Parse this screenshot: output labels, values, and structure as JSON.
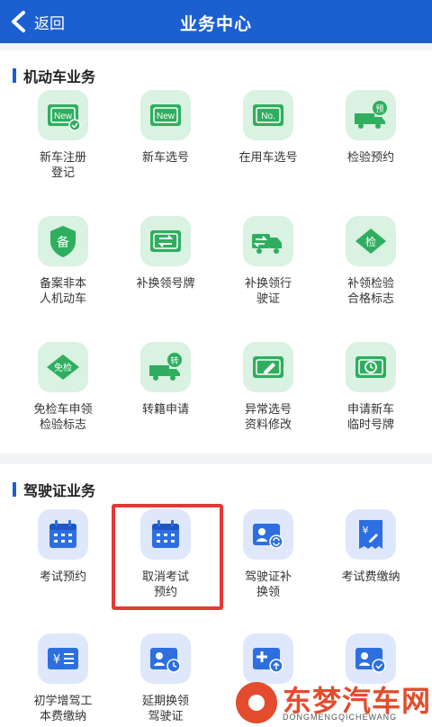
{
  "header": {
    "back_label": "返回",
    "title": "业务中心"
  },
  "motor": {
    "title": "机动车业务",
    "items": [
      {
        "label": "新车注册\n登记",
        "icon": "new-car-register-icon"
      },
      {
        "label": "新车选号",
        "icon": "new-plate-icon"
      },
      {
        "label": "在用车选号",
        "icon": "number-plate-icon"
      },
      {
        "label": "检验预约",
        "icon": "truck-reserve-icon"
      },
      {
        "label": "备案非本\n人机动车",
        "icon": "record-shield-icon"
      },
      {
        "label": "补换领号牌",
        "icon": "plate-exchange-icon"
      },
      {
        "label": "补换领行\n驶证",
        "icon": "license-exchange-icon"
      },
      {
        "label": "补领检验\n合格标志",
        "icon": "inspection-badge-icon"
      },
      {
        "label": "免检车申领\n检验标志",
        "icon": "exempt-badge-icon"
      },
      {
        "label": "转籍申请",
        "icon": "truck-transfer-icon"
      },
      {
        "label": "异常选号\n资料修改",
        "icon": "edit-plate-icon"
      },
      {
        "label": "申请新车\n临时号牌",
        "icon": "temp-plate-icon"
      }
    ]
  },
  "driving": {
    "title": "驾驶证业务",
    "items": [
      {
        "label": "考试预约",
        "icon": "calendar-icon"
      },
      {
        "label": "取消考试\n预约",
        "icon": "calendar-cancel-icon"
      },
      {
        "label": "驾驶证补\n换领",
        "icon": "license-renew-icon"
      },
      {
        "label": "考试费缴纳",
        "icon": "receipt-icon"
      },
      {
        "label": "初学增驾工\n本费缴纳",
        "icon": "fee-icon"
      },
      {
        "label": "延期换领\n驾驶证",
        "icon": "license-delay-icon"
      },
      {
        "label": "",
        "icon": "license-add-icon"
      },
      {
        "label": "",
        "icon": "license-check-icon"
      }
    ]
  },
  "watermark": {
    "text": "东梦汽车网",
    "sub": "DONGMENGQICHEWANG"
  },
  "colors": {
    "primary": "#1c5fd1",
    "green": "#2fae5f",
    "green_bg": "#d9f2e1",
    "blue_bg": "#dfe7fb",
    "highlight": "#e53935"
  }
}
